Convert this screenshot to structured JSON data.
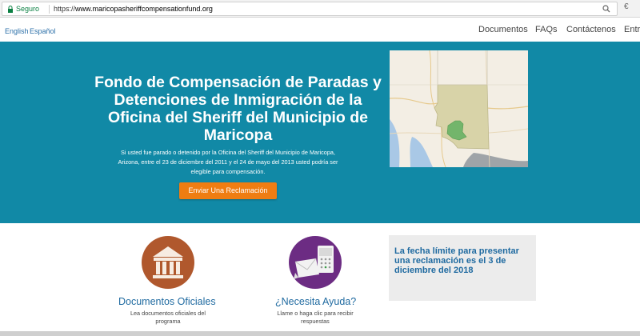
{
  "browser": {
    "secure_label": "Seguro",
    "url_scheme": "https://",
    "url_host": "www.maricopasheriffcompensationfund.org",
    "right_glyph": "€"
  },
  "nav": {
    "lang_english": "English",
    "lang_spanish": "Español",
    "links": [
      "Documentos",
      "FAQs",
      "Contáctenos",
      "Entrar"
    ]
  },
  "hero": {
    "title": "Fondo de Compensación de Paradas y Detenciones de Inmigración de la Oficina del Sheriff del Municipio de Maricopa",
    "description": "Si usted fue parado o detenido por la Oficina del Sheriff del Municipio de Maricopa, Arizona, entre el 23 de diciembre del 2011 y el 24 de mayo del 2013 usted podría ser elegible para compensación.",
    "cta_label": "Enviar Una Reclamación",
    "cta_color": "#ef7d12",
    "background_color": "#1189a6"
  },
  "cards": {
    "docs": {
      "title": "Documentos Oficiales",
      "description": "Lea documentos oficiales del programa",
      "icon": "building-columns-icon",
      "circle_color": "#b0582d"
    },
    "help": {
      "title": "¿Necesita Ayuda?",
      "description": "Llame o haga clic para recibir respuestas",
      "icon": "phone-envelope-icon",
      "circle_color": "#6c2c83"
    }
  },
  "deadline": {
    "text": "La fecha límite para presentar una reclamación es el 3 de diciembre del 2018"
  }
}
